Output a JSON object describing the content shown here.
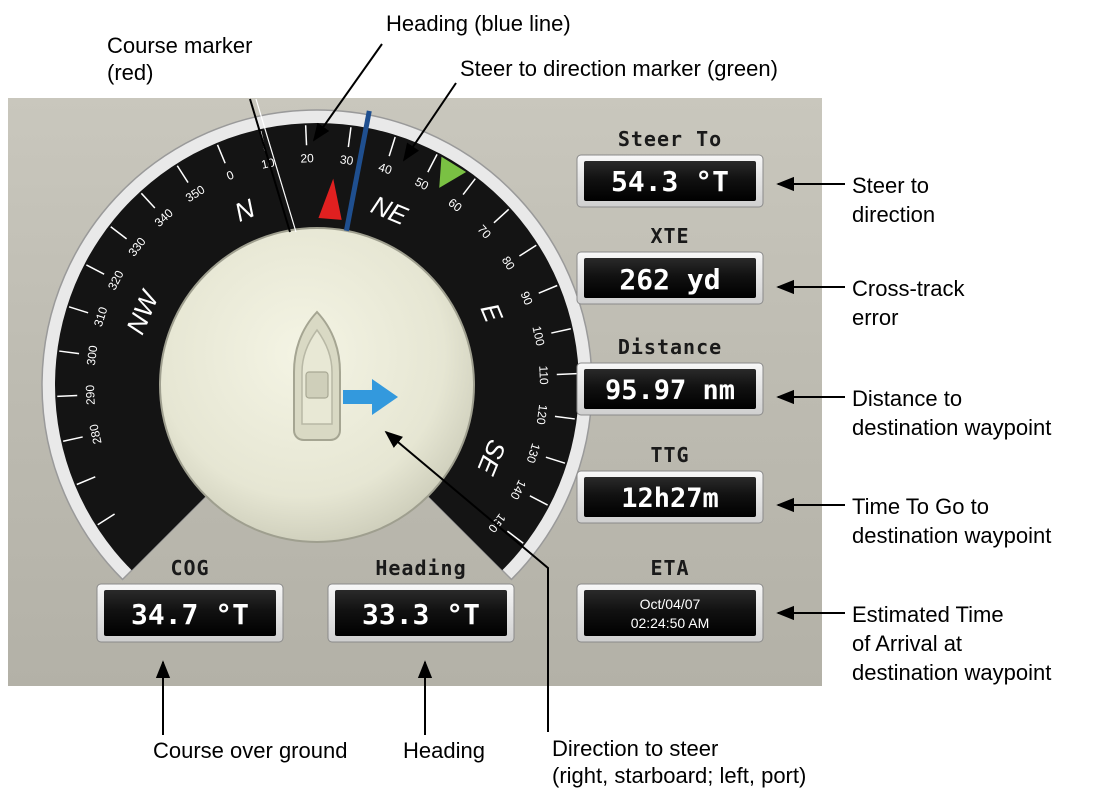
{
  "display": {
    "dial": {
      "tick_labels": [
        "280",
        "290",
        "300",
        "310",
        "320",
        "330",
        "340",
        "350",
        "0",
        "10",
        "20",
        "30",
        "40",
        "50",
        "60",
        "70",
        "80",
        "90",
        "100",
        "110",
        "120",
        "130",
        "140",
        "150"
      ],
      "cardinals": [
        "NW",
        "N",
        "NE",
        "E",
        "SE"
      ],
      "heading_deg": 33.3,
      "course_deg": 27,
      "steer_to_deg": 54.3
    },
    "boxes": {
      "steer_to": {
        "label": "Steer To",
        "value": "54.3 °T"
      },
      "xte": {
        "label": "XTE",
        "value": "262 yd"
      },
      "distance": {
        "label": "Distance",
        "value": "95.97 nm"
      },
      "ttg": {
        "label": "TTG",
        "value": "12h27m"
      },
      "eta": {
        "label": "ETA",
        "date": "Oct/04/07",
        "time": "02:24:50 AM"
      },
      "cog": {
        "label": "COG",
        "value": "34.7 °T"
      },
      "heading": {
        "label": "Heading",
        "value": "33.3 °T"
      }
    },
    "direction_arrow": "right-arrow-icon",
    "colors": {
      "course_marker": "#e02020",
      "heading_line": "#1f4f8f",
      "steer_marker": "#7ac143",
      "direction_arrow": "#3399dd"
    }
  },
  "annotations": {
    "course_marker": [
      "Course marker",
      "(red)"
    ],
    "heading_line": "Heading (blue line)",
    "steer_marker": "Steer to direction marker (green)",
    "steer_to": [
      "Steer to",
      "direction"
    ],
    "xte": [
      "Cross-track",
      "error"
    ],
    "distance": [
      "Distance to",
      "destination waypoint"
    ],
    "ttg": [
      "Time To Go to",
      "destination waypoint"
    ],
    "eta": [
      "Estimated Time",
      "of Arrival at",
      "destination waypoint"
    ],
    "cog": "Course over ground",
    "heading": "Heading",
    "direction": [
      "Direction to steer",
      "(right, starboard; left, port)"
    ]
  }
}
